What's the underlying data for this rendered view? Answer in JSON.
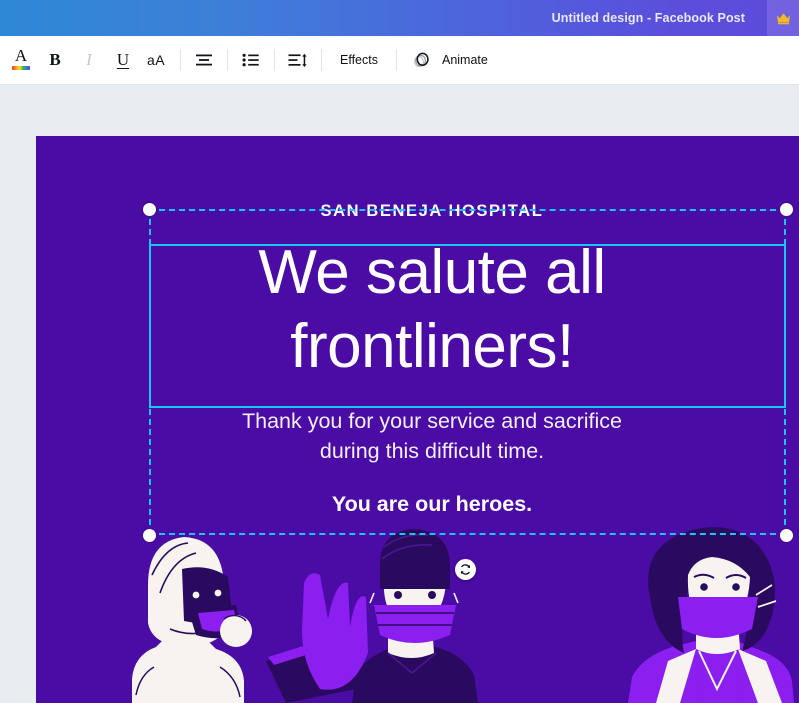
{
  "header": {
    "document_title": "Untitled design - Facebook Post",
    "pro_badge_icon": "crown-icon",
    "gradient_from": "#2e88d6",
    "gradient_to": "#5d4bdb"
  },
  "toolbar": {
    "items": [
      {
        "name": "text-color",
        "icon": "text-color-a-icon",
        "label": "A"
      },
      {
        "name": "bold",
        "icon": "bold-icon",
        "label": "B"
      },
      {
        "name": "italic",
        "icon": "italic-icon",
        "label": "I"
      },
      {
        "name": "underline",
        "icon": "underline-icon",
        "label": "U"
      },
      {
        "name": "letter-case",
        "icon": "letter-case-icon",
        "label": "aA"
      },
      {
        "name": "align",
        "icon": "align-center-icon",
        "label": ""
      },
      {
        "name": "list",
        "icon": "bulleted-list-icon",
        "label": ""
      },
      {
        "name": "spacing",
        "icon": "line-spacing-icon",
        "label": ""
      },
      {
        "name": "effects",
        "icon": "",
        "label": "Effects"
      },
      {
        "name": "animate",
        "icon": "animate-icon",
        "label": "Animate"
      }
    ],
    "effects_label": "Effects",
    "animate_label": "Animate"
  },
  "canvas": {
    "background_color": "#4b0ba5",
    "selection_color": "#18c6f5",
    "rotate_icon": "rotate-icon",
    "design": {
      "eyebrow": "SAN BENEJA HOSPITAL",
      "headline": "We salute all\nfrontliners!",
      "body": "Thank you for your service and sacrifice\nduring this difficult time.",
      "closing": "You are our heroes."
    },
    "illustration": {
      "alt": "three healthcare workers in protective gear and face masks",
      "figures": [
        "ppe-worker-with-respirator",
        "surgeon-with-cap-and-mask",
        "nurse-with-curly-hair-and-mask"
      ],
      "mask_color": "#8a1ff0",
      "dark_color": "#2a0a5e",
      "light_color": "#f7f4ef"
    }
  }
}
